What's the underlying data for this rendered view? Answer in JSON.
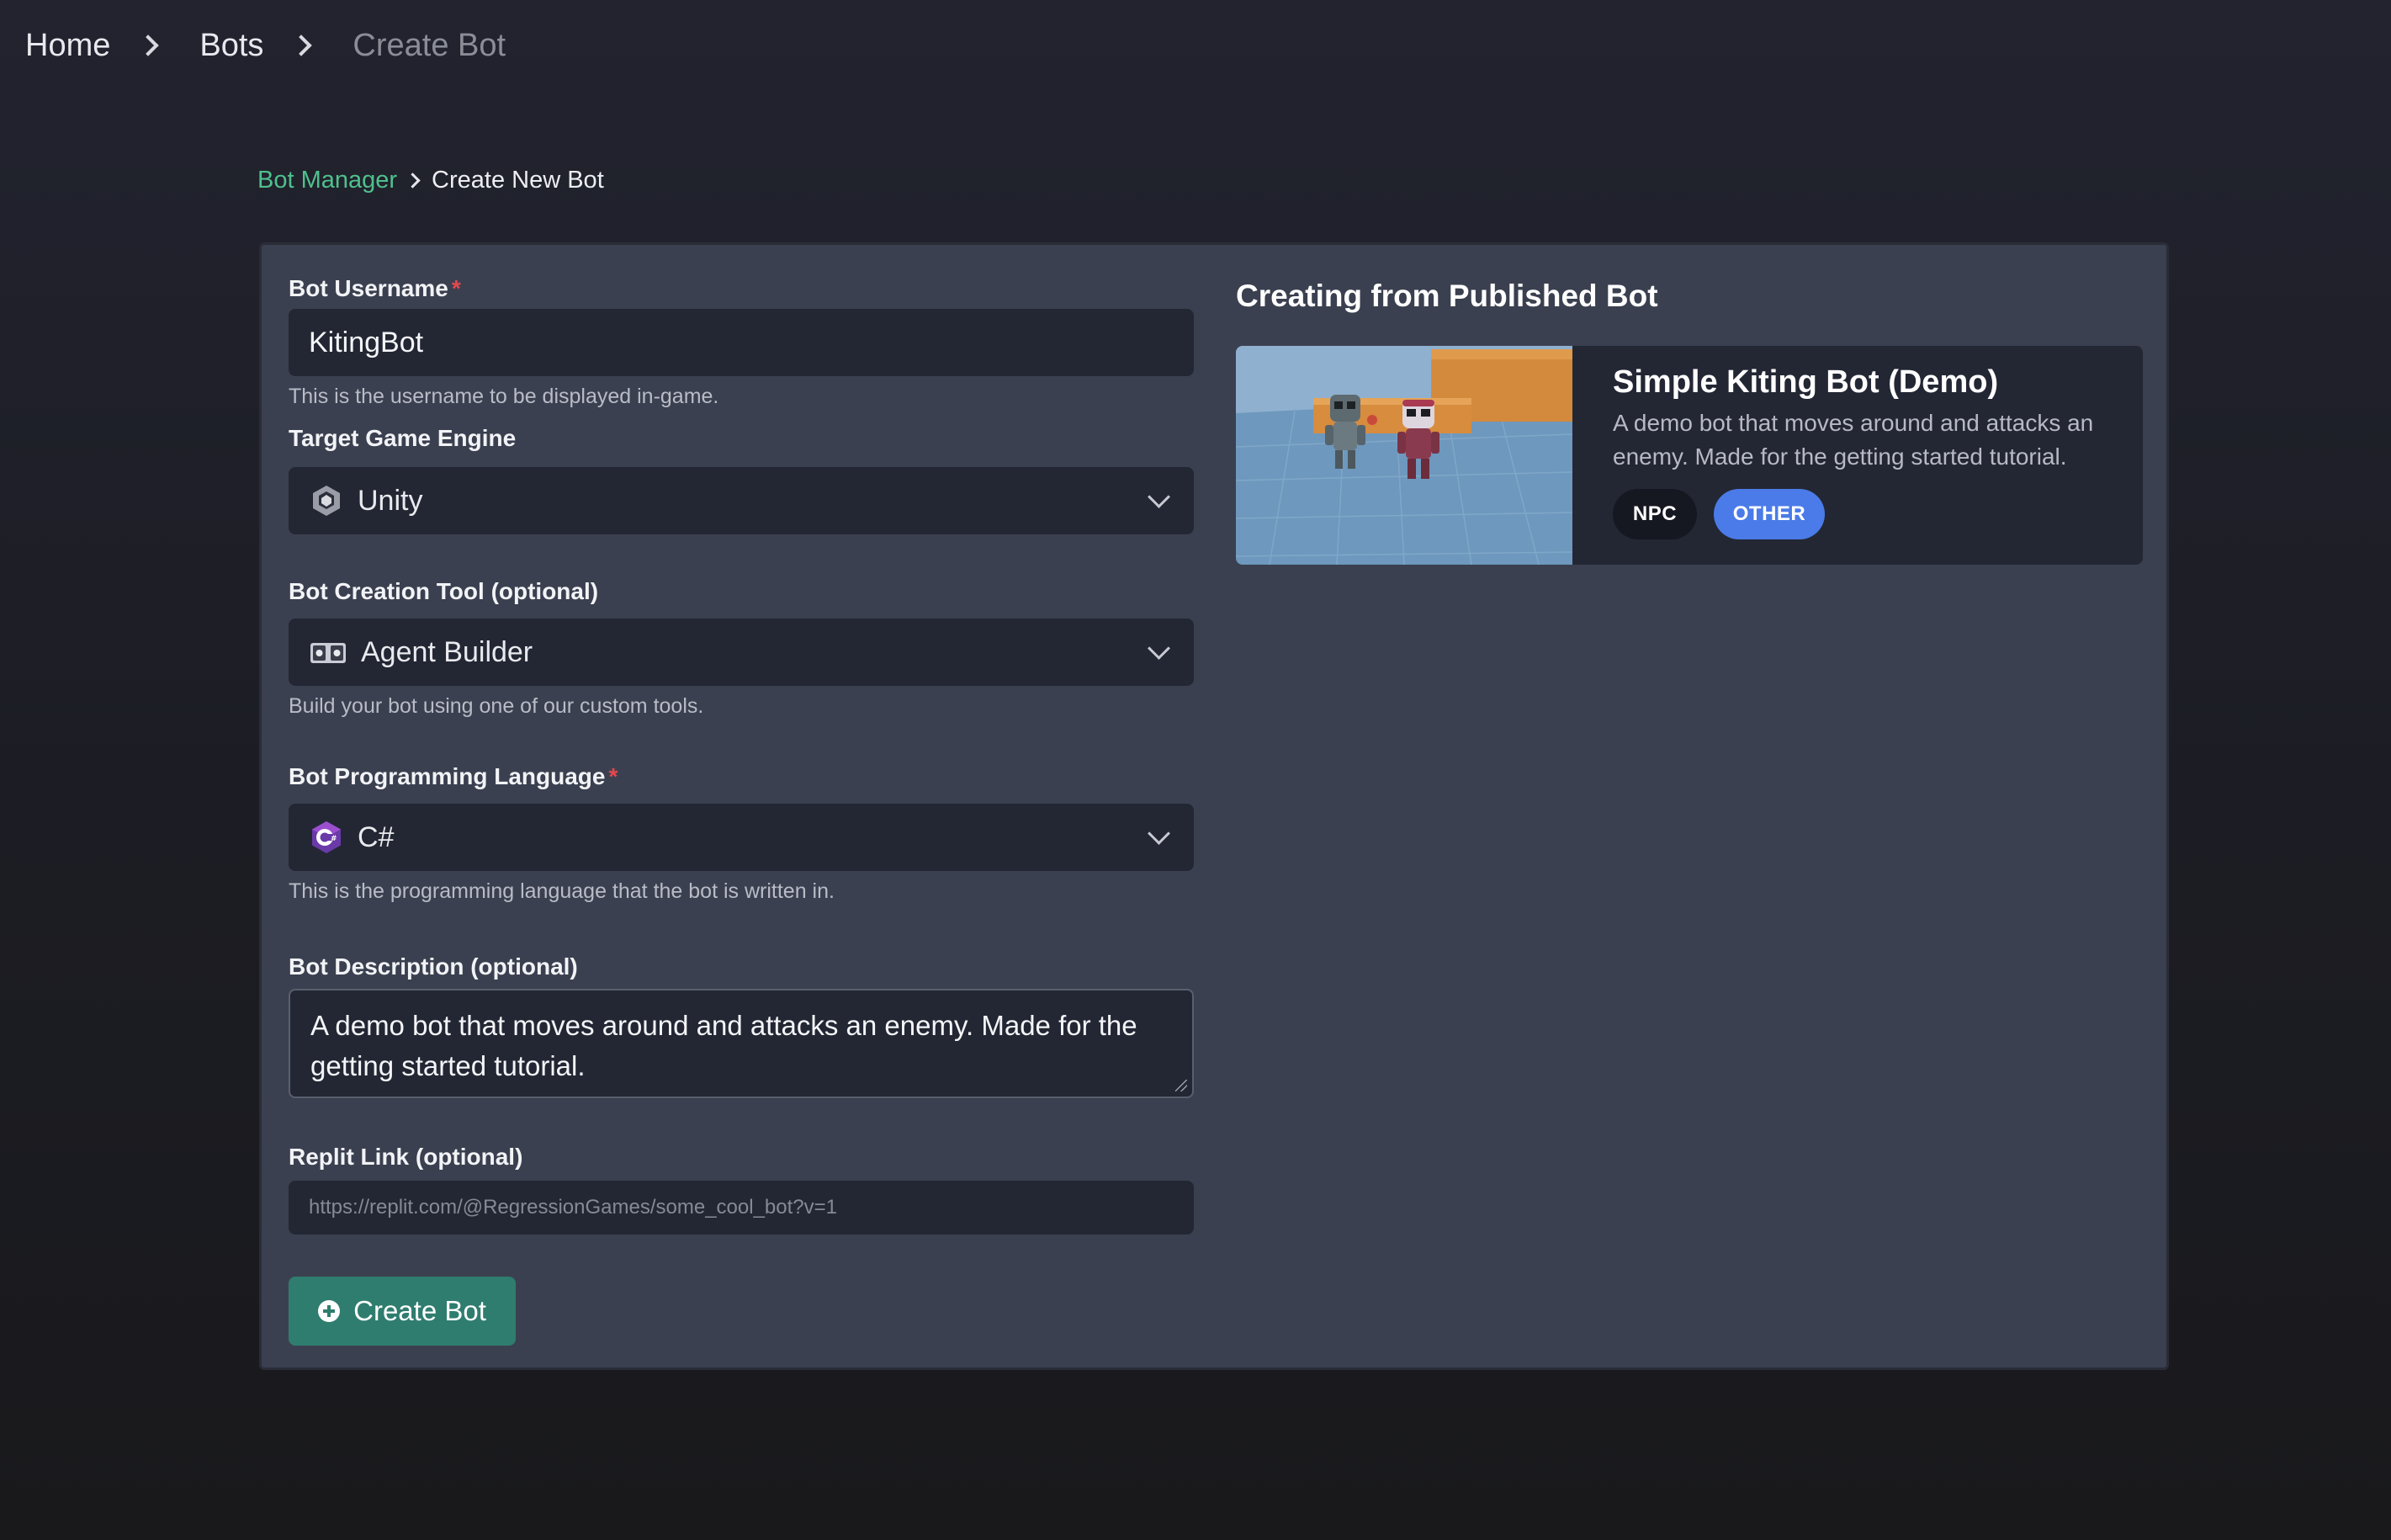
{
  "breadcrumb": {
    "items": [
      "Home",
      "Bots",
      "Create Bot"
    ]
  },
  "sub_breadcrumb": {
    "link": "Bot Manager",
    "current": "Create New Bot"
  },
  "form": {
    "username": {
      "label": "Bot Username",
      "required_mark": "*",
      "value": "KitingBot",
      "help": "This is the username to be displayed in-game."
    },
    "engine": {
      "label": "Target Game Engine",
      "value": "Unity",
      "icon": "unity-icon"
    },
    "creation_tool": {
      "label": "Bot Creation Tool (optional)",
      "value": "Agent Builder",
      "icon": "agent-builder-icon",
      "help": "Build your bot using one of our custom tools."
    },
    "language": {
      "label": "Bot Programming Language",
      "required_mark": "*",
      "value": "C#",
      "icon": "csharp-icon",
      "help": "This is the programming language that the bot is written in."
    },
    "description": {
      "label": "Bot Description (optional)",
      "value": "A demo bot that moves around and attacks an enemy. Made for the getting started tutorial."
    },
    "replit": {
      "label": "Replit Link (optional)",
      "placeholder": "https://replit.com/@RegressionGames/some_cool_bot?v=1"
    },
    "submit_label": "Create Bot"
  },
  "published": {
    "heading": "Creating from Published Bot",
    "bot": {
      "title": "Simple Kiting Bot (Demo)",
      "description": "A demo bot that moves around and attacks an enemy. Made for the getting started tutorial.",
      "tags": [
        "NPC",
        "OTHER"
      ]
    }
  },
  "colors": {
    "accent_green": "#4fc08d",
    "button": "#2f7d6f",
    "required": "#e5484d",
    "tag_other": "#4a7be8"
  }
}
